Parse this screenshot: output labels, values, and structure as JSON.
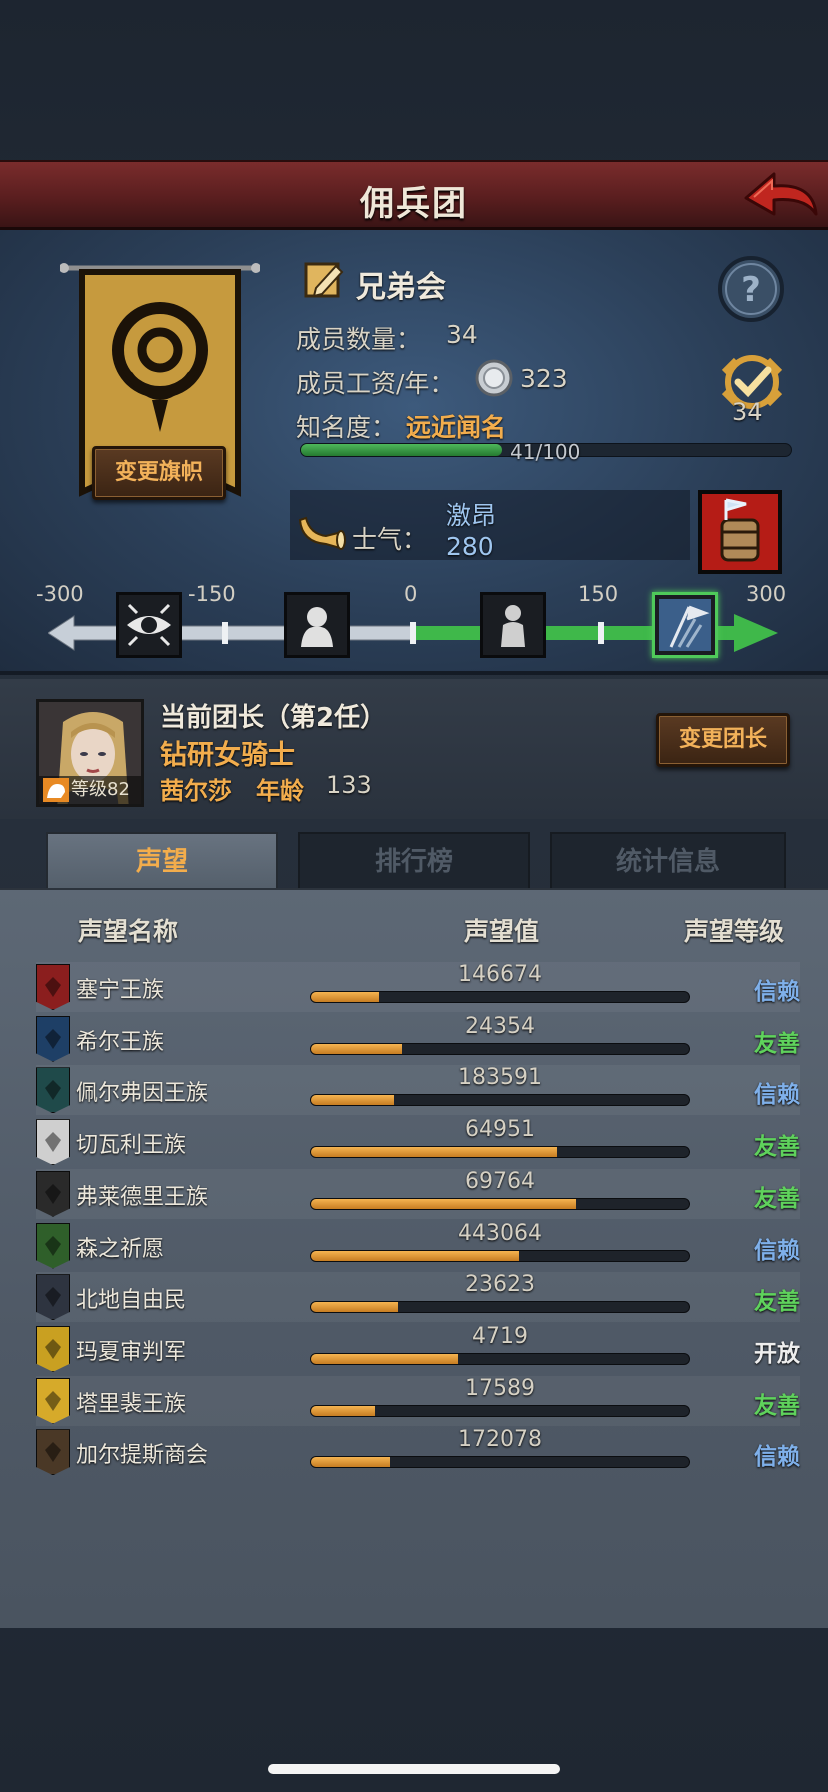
{
  "header": {
    "title": "佣兵团"
  },
  "guild": {
    "name": "兄弟会",
    "member_count_label": "成员数量：",
    "member_count": "34",
    "salary_label": "成员工资/年：",
    "salary": "323",
    "fame_label": "知名度：",
    "fame_value": "远近闻名",
    "fame_progress_text": "41/100",
    "fame_progress": 0.41,
    "change_banner_label": "变更旗帜",
    "badge_count": "34",
    "morale_label": "士气：",
    "morale_state": "激昂",
    "morale_value": "280"
  },
  "morale_scale": {
    "ticks": [
      "-300",
      "-150",
      "0",
      "150",
      "300"
    ],
    "current": 280,
    "min": -300,
    "max": 300
  },
  "leader": {
    "heading": "当前团长（第2任）",
    "title": "钻研女骑士",
    "name": "茜尔莎",
    "age_label": "年龄",
    "age": "133",
    "level_text": "等级82",
    "change_leader_label": "变更团长"
  },
  "tabs": [
    {
      "label": "声望"
    },
    {
      "label": "排行榜"
    },
    {
      "label": "统计信息"
    }
  ],
  "table": {
    "headers": {
      "name": "声望名称",
      "value": "声望值",
      "level": "声望等级"
    },
    "rows": [
      {
        "name": "塞宁王族",
        "value": "146674",
        "level": "信赖",
        "progress": 0.18,
        "icon_color": "#8b1e1e",
        "level_color": "#7fb0ea"
      },
      {
        "name": "希尔王族",
        "value": "24354",
        "level": "友善",
        "progress": 0.24,
        "icon_color": "#1e3f66",
        "level_color": "#5fd25c"
      },
      {
        "name": "佩尔弗因王族",
        "value": "183591",
        "level": "信赖",
        "progress": 0.22,
        "icon_color": "#1f4a4a",
        "level_color": "#7fb0ea"
      },
      {
        "name": "切瓦利王族",
        "value": "64951",
        "level": "友善",
        "progress": 0.65,
        "icon_color": "#cfcfcf",
        "level_color": "#5fd25c"
      },
      {
        "name": "弗莱德里王族",
        "value": "69764",
        "level": "友善",
        "progress": 0.7,
        "icon_color": "#2a2a2a",
        "level_color": "#5fd25c"
      },
      {
        "name": "森之祈愿",
        "value": "443064",
        "level": "信赖",
        "progress": 0.55,
        "icon_color": "#2f5f2a",
        "level_color": "#7fb0ea"
      },
      {
        "name": "北地自由民",
        "value": "23623",
        "level": "友善",
        "progress": 0.23,
        "icon_color": "#2e3440",
        "level_color": "#5fd25c"
      },
      {
        "name": "玛夏审判军",
        "value": "4719",
        "level": "开放",
        "progress": 0.39,
        "icon_color": "#c9a021",
        "level_color": "#eeeeee"
      },
      {
        "name": "塔里裴王族",
        "value": "17589",
        "level": "友善",
        "progress": 0.17,
        "icon_color": "#d6aa2a",
        "level_color": "#5fd25c"
      },
      {
        "name": "加尔提斯商会",
        "value": "172078",
        "level": "信赖",
        "progress": 0.21,
        "icon_color": "#4a3826",
        "level_color": "#7fb0ea"
      }
    ]
  }
}
